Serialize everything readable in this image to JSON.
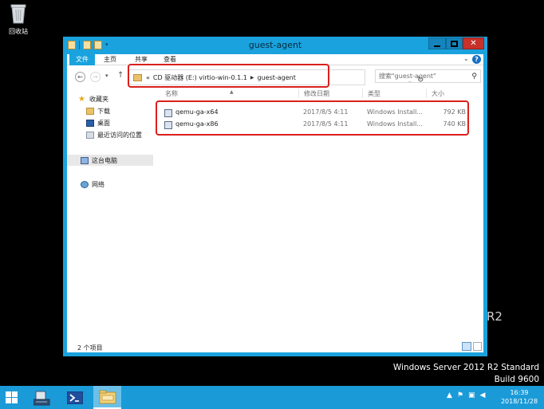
{
  "desktop": {
    "recycle_bin_label": "回收站",
    "os_fragment": "R2",
    "os_line1": "Windows Server 2012 R2 Standard",
    "os_line2": "Build 9600"
  },
  "window": {
    "title": "guest-agent",
    "accent_color": "#19a2de",
    "ribbon_tabs": [
      "文件",
      "主页",
      "共享",
      "查看"
    ]
  },
  "address": {
    "prefix": "«",
    "crumbs": [
      "CD 驱动器 (E:) virtio-win-0.1.1",
      "guest-agent"
    ],
    "search_placeholder": "搜索\"guest-agent\""
  },
  "navpane": {
    "favorites": "收藏夹",
    "downloads": "下载",
    "desktop": "桌面",
    "recent": "最近访问的位置",
    "this_pc": "这台电脑",
    "network": "网络"
  },
  "filelist": {
    "columns": [
      "名称",
      "修改日期",
      "类型",
      "大小"
    ],
    "rows": [
      {
        "name": "qemu-ga-x64",
        "date": "2017/8/5 4:11",
        "type": "Windows Install...",
        "size": "792 KB"
      },
      {
        "name": "qemu-ga-x86",
        "date": "2017/8/5 4:11",
        "type": "Windows Install...",
        "size": "740 KB"
      }
    ]
  },
  "statusbar": {
    "count": "2 个项目"
  },
  "taskbar": {
    "time": "16:39",
    "date": "2018/11/28",
    "color": "#1b9ad8"
  }
}
